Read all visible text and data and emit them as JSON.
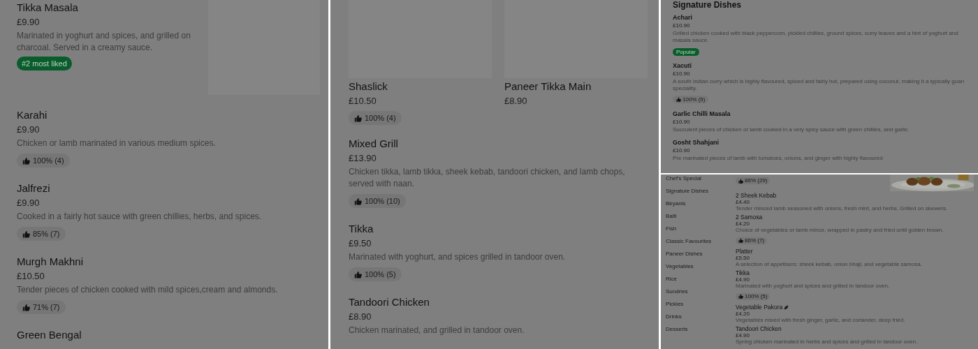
{
  "left_panel": {
    "dishes": [
      {
        "name": "Tikka Masala",
        "price": "£9.90",
        "description": "Marinated in yoghurt and spices, and grilled on charcoal. Served in a creamy sauce.",
        "badge": "#2 most liked",
        "thumbnail": true
      },
      {
        "name": "Karahi",
        "price": "£9.90",
        "description": "Chicken or lamb marinated in various medium spices.",
        "rating": "100% (4)"
      },
      {
        "name": "Jalfrezi",
        "price": "£9.90",
        "description": "Cooked in a fairly hot sauce with green chillies, herbs, and spices.",
        "rating": "85% (7)"
      },
      {
        "name": "Murgh Makhni",
        "price": "£10.50",
        "description": "Tender pieces of chicken cooked with mild spices,cream and almonds.",
        "rating": "71% (7)"
      },
      {
        "name": "Green Bengal"
      }
    ]
  },
  "middle_panel": {
    "tiles": [
      {
        "name": "Shaslick",
        "price": "£10.50",
        "rating": "100% (4)"
      },
      {
        "name": "Paneer Tikka Main",
        "price": "£8.90"
      }
    ],
    "dishes": [
      {
        "name": "Mixed Grill",
        "price": "£13.90",
        "description": "Chicken tikka, lamb tikka, sheek kebab, tandoori chicken, and lamb chops, served with naan.",
        "rating": "100% (10)"
      },
      {
        "name": "Tikka",
        "price": "£9.50",
        "description": "Marinated with yoghurt, and spices grilled in tandoor oven.",
        "rating": "100% (5)"
      },
      {
        "name": "Tandoori Chicken",
        "price": "£8.90",
        "description": "Chicken marinated, and grilled in tandoor oven."
      }
    ]
  },
  "signature_panel": {
    "heading": "Signature Dishes",
    "dishes": [
      {
        "name": "Achari",
        "price": "£10.90",
        "description": "Grilled chicken cooked with black peppercorn, pickled chillies, ground spices, curry leaves and a hint of yoghurt and masala sauce.",
        "badge": "Popular"
      },
      {
        "name": "Xacuti",
        "price": "£10.90",
        "description": "A south Indian curry which is highly flavoured, spiced and fairly hot, prepared using coconut, making it a typically goan speciality.",
        "rating": "100% (5)"
      },
      {
        "name": "Garlic Chilli Masala",
        "price": "£10.90",
        "description": "Succulent pieces of chicken or lamb cooked in a very spicy sauce with green chillies, and garlic"
      },
      {
        "name": "Gosht Shahjani",
        "price": "£10.90",
        "description": "Pre marinated pieces of lamb with tomatoes, onions, and ginger with highly flavoured"
      }
    ]
  },
  "starters_panel": {
    "categories": [
      {
        "label": "Chef's Special"
      },
      {
        "label": "Signature Dishes"
      },
      {
        "label": "Biryanis"
      },
      {
        "label": "Balti"
      },
      {
        "label": "Fish"
      },
      {
        "label": "Classic Favourites"
      },
      {
        "label": "Paneer Dishes"
      },
      {
        "label": "Vegetables"
      },
      {
        "label": "Rice"
      },
      {
        "label": "Sundries"
      },
      {
        "label": "Pickles"
      },
      {
        "label": "Drinks"
      },
      {
        "label": "Desserts"
      }
    ],
    "top_rating": "86% (29)",
    "dishes": [
      {
        "name": "2 Sheek Kebab",
        "price": "£4.40",
        "description": "Tender minced lamb seasoned with onions, fresh mint, and herbs. Grilled on skewers."
      },
      {
        "name": "2 Samosa",
        "price": "£4.20",
        "description": "Choice of vegetables or lamb mince, wrapped in pastry and fried until golden brown.",
        "rating": "86% (7)"
      },
      {
        "name": "Platter",
        "price": "£5.50",
        "description": "A selection of appetisers: sheek kebab, onion bhaji, and vegetable samosa."
      },
      {
        "name": "Tikka",
        "price": "£4.90",
        "description": "Marinated with yoghurt and spices and grilled in tandoor oven.",
        "rating": "100% (5)"
      },
      {
        "name": "Vegetable Pakora",
        "vegetarian": true,
        "price": "£4.20",
        "description": "Vegetables mixed with fresh ginger, garlic, and coriander, deep fried."
      },
      {
        "name": "Tandoori Chicken",
        "price": "£4.90",
        "description": "Spring chicken marinated in herbs and spices and grilled in tandoor oven."
      }
    ]
  }
}
